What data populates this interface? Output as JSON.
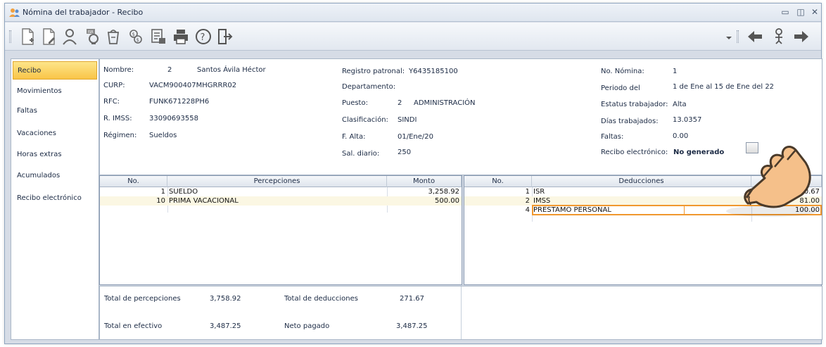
{
  "window": {
    "title": "Nómina del trabajador - Recibo"
  },
  "toolbar": {
    "icons": [
      "new-document-icon",
      "edit-document-icon",
      "employee-icon",
      "payroll-calc-icon",
      "gift-bag-icon",
      "money-icon",
      "stamp-receipt-icon",
      "print-icon",
      "help-icon",
      "exit-icon",
      "dropdown-icon",
      "back-arrow-icon",
      "person-icon",
      "forward-arrow-icon"
    ]
  },
  "sidebar": {
    "items": [
      {
        "label": "Recibo",
        "active": true
      },
      {
        "label": "Movimientos"
      },
      {
        "label": "Faltas"
      },
      {
        "label": "Vacaciones"
      },
      {
        "label": "Horas extras"
      },
      {
        "label": "Acumulados"
      },
      {
        "label": "Recibo electrónico"
      }
    ]
  },
  "employee": {
    "nombre_label": "Nombre:",
    "nombre_num": "2",
    "nombre": "Santos Ávila Héctor",
    "curp_label": "CURP:",
    "curp": "VACM900407MHGRRR02",
    "rfc_label": "RFC:",
    "rfc": "FUNK671228PH6",
    "imss_label": "R. IMSS:",
    "imss": "33090693558",
    "regimen_label": "Régimen:",
    "regimen": "Sueldos",
    "registro_label": "Registro patronal:",
    "registro": "Y6435185100",
    "departamento_label": "Departamento:",
    "puesto_label": "Puesto:",
    "puesto_num": "2",
    "puesto": "ADMINISTRACIÓN",
    "clasificacion_label": "Clasificación:",
    "clasificacion": "SINDI",
    "alta_label": "F. Alta:",
    "alta": "01/Ene/20",
    "sal_label": "Sal. diario:",
    "sal": "250",
    "nomina_label": "No. Nómina:",
    "nomina": "1",
    "periodo_label": "Periodo del",
    "periodo": "1 de Ene al 15 de Ene del 22",
    "estatus_label": "Estatus trabajador:",
    "estatus": "Alta",
    "dias_label": "Días trabajados:",
    "dias": "13.0357",
    "faltas_label": "Faltas:",
    "faltas": "0.00",
    "recibo_label": "Recibo electrónico:",
    "recibo": "No generado"
  },
  "percepciones": {
    "headers": [
      "No.",
      "Percepciones",
      "Monto"
    ],
    "rows": [
      {
        "no": "1",
        "concepto": "SUELDO",
        "monto": "3,258.92"
      },
      {
        "no": "10",
        "concepto": "PRIMA VACACIONAL",
        "monto": "500.00"
      }
    ]
  },
  "deducciones": {
    "headers": [
      "No.",
      "Deducciones",
      ""
    ],
    "rows": [
      {
        "no": "1",
        "concepto": "ISR",
        "monto": "90.67"
      },
      {
        "no": "2",
        "concepto": "IMSS",
        "monto": "81.00"
      },
      {
        "no": "4",
        "concepto": "PRESTAMO PERSONAL",
        "monto": "100.00",
        "highlighted": true
      }
    ]
  },
  "totals": {
    "total_percepciones_label": "Total de percepciones",
    "total_percepciones": "3,758.92",
    "total_deducciones_label": "Total de deducciones",
    "total_deducciones": "271.67",
    "total_efectivo_label": "Total en efectivo",
    "total_efectivo": "3,487.25",
    "neto_label": "Neto pagado",
    "neto": "3,487.25"
  },
  "colors": {
    "highlight": "#f0972e",
    "active_tab": "#f9c548",
    "hand": "#f5c08a"
  }
}
